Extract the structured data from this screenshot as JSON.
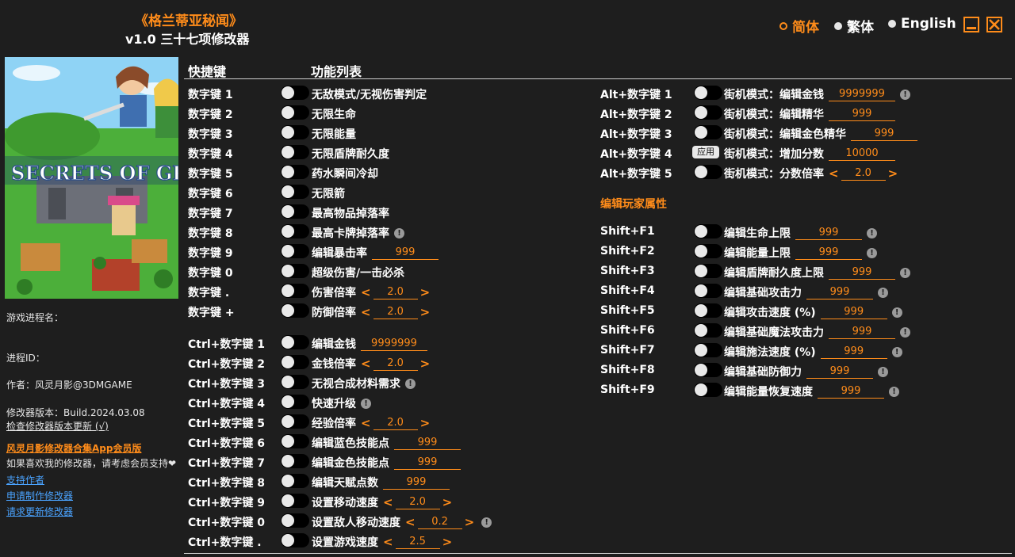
{
  "header": {
    "title": "《格兰蒂亚秘闻》",
    "version": "v1.0 三十七项修改器",
    "languages": [
      "简体",
      "繁体",
      "English"
    ],
    "selected_language": "简体",
    "accent": "#ff8c1a"
  },
  "left": {
    "game_logo": "SECRETS OF GRINDEA",
    "process_name_label": "游戏进程名：",
    "process_id_label": "进程ID：",
    "author": "作者：风灵月影@3DMGAME",
    "version": "修改器版本：Build.2024.03.08",
    "check_update": "检查修改器版本更新 (√)",
    "app_promo": "风灵月影修改器合集App会员版",
    "support_text": "如果喜欢我的修改器，请考虑会员支持❤",
    "links": [
      "支持作者",
      "申请制作修改器",
      "请求更新修改器"
    ]
  },
  "columns": {
    "hotkey": "快捷键",
    "features": "功能列表"
  },
  "left_rows": [
    {
      "key": "数字键 1",
      "label": "无敌模式/无视伤害判定"
    },
    {
      "key": "数字键 2",
      "label": "无限生命"
    },
    {
      "key": "数字键 3",
      "label": "无限能量"
    },
    {
      "key": "数字键 4",
      "label": "无限盾牌耐久度"
    },
    {
      "key": "数字键 5",
      "label": "药水瞬间冷却"
    },
    {
      "key": "数字键 6",
      "label": "无限箭"
    },
    {
      "key": "数字键 7",
      "label": "最高物品掉落率"
    },
    {
      "key": "数字键 8",
      "label": "最高卡牌掉落率",
      "warn": true
    },
    {
      "key": "数字键 9",
      "label": "编辑暴击率",
      "value": "999"
    },
    {
      "key": "数字键 0",
      "label": "超级伤害/一击必杀"
    },
    {
      "key": "数字键 .",
      "label": "伤害倍率",
      "value": "2.0",
      "arrows": true
    },
    {
      "key": "数字键 +",
      "label": "防御倍率",
      "value": "2.0",
      "arrows": true
    },
    {
      "key": "Ctrl+数字键 1",
      "label": "编辑金钱",
      "value": "9999999"
    },
    {
      "key": "Ctrl+数字键 2",
      "label": "金钱倍率",
      "value": "2.0",
      "arrows": true
    },
    {
      "key": "Ctrl+数字键 3",
      "label": "无视合成材料需求",
      "warn": true
    },
    {
      "key": "Ctrl+数字键 4",
      "label": "快速升级",
      "warn": true
    },
    {
      "key": "Ctrl+数字键 5",
      "label": "经验倍率",
      "value": "2.0",
      "arrows": true
    },
    {
      "key": "Ctrl+数字键 6",
      "label": "编辑蓝色技能点",
      "value": "999"
    },
    {
      "key": "Ctrl+数字键 7",
      "label": "编辑金色技能点",
      "value": "999"
    },
    {
      "key": "Ctrl+数字键 8",
      "label": "编辑天赋点数",
      "value": "999"
    },
    {
      "key": "Ctrl+数字键 9",
      "label": "设置移动速度",
      "value": "2.0",
      "arrows": true
    },
    {
      "key": "Ctrl+数字键 0",
      "label": "设置敌人移动速度",
      "value": "0.2",
      "arrows": true,
      "warn": true
    },
    {
      "key": "Ctrl+数字键 .",
      "label": "设置游戏速度",
      "value": "2.5",
      "arrows": true
    }
  ],
  "right_rows": [
    {
      "key": "Alt+数字键 1",
      "label": "街机模式：编辑金钱",
      "value": "9999999",
      "warn": true
    },
    {
      "key": "Alt+数字键 2",
      "label": "街机模式：编辑精华",
      "value": "999"
    },
    {
      "key": "Alt+数字键 3",
      "label": "街机模式：编辑金色精华",
      "value": "999"
    },
    {
      "key": "Alt+数字键 4",
      "label": "街机模式：增加分数",
      "value": "10000",
      "apply": "应用"
    },
    {
      "key": "Alt+数字键 5",
      "label": "街机模式：分数倍率",
      "value": "2.0",
      "arrows": true
    }
  ],
  "player_section": "编辑玩家属性",
  "player_rows": [
    {
      "key": "Shift+F1",
      "label": "编辑生命上限",
      "value": "999",
      "warn": true
    },
    {
      "key": "Shift+F2",
      "label": "编辑能量上限",
      "value": "999",
      "warn": true
    },
    {
      "key": "Shift+F3",
      "label": "编辑盾牌耐久度上限",
      "value": "999",
      "warn": true
    },
    {
      "key": "Shift+F4",
      "label": "编辑基础攻击力",
      "value": "999",
      "warn": true
    },
    {
      "key": "Shift+F5",
      "label": "编辑攻击速度 (%)",
      "value": "999",
      "warn": true
    },
    {
      "key": "Shift+F6",
      "label": "编辑基础魔法攻击力",
      "value": "999",
      "warn": true
    },
    {
      "key": "Shift+F7",
      "label": "编辑施法速度 (%)",
      "value": "999",
      "warn": true
    },
    {
      "key": "Shift+F8",
      "label": "编辑基础防御力",
      "value": "999",
      "warn": true
    },
    {
      "key": "Shift+F9",
      "label": "编辑能量恢复速度",
      "value": "999",
      "warn": true
    }
  ]
}
